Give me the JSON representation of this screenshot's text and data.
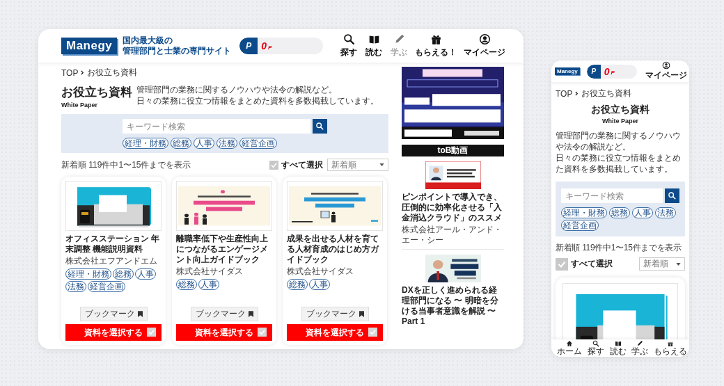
{
  "desktop": {
    "header": {
      "logo": "Manegy",
      "tagline": [
        "国内最大級の",
        "管理部門と士業の専門サイト"
      ],
      "points": {
        "badge": "P",
        "value": "0",
        "unit": "P"
      },
      "nav": [
        {
          "label": "探す",
          "disabled": false
        },
        {
          "label": "読む",
          "disabled": false
        },
        {
          "label": "学ぶ",
          "disabled": true
        },
        {
          "label": "もらえる！",
          "disabled": false
        },
        {
          "label": "マイページ",
          "disabled": false
        }
      ]
    },
    "breadcrumb": [
      "TOP",
      "お役立ち資料"
    ],
    "title": "お役立ち資料",
    "subtitle": "White Paper",
    "description": [
      "管理部門の業務に関するノウハウや法令の解説など。",
      "日々の業務に役立つ情報をまとめた資料を多数掲載しています。"
    ],
    "search": {
      "placeholder": "キーワード検索",
      "tags": [
        "経理・財務",
        "総務",
        "人事",
        "法務",
        "経営企画"
      ]
    },
    "results": {
      "summary": "新着順 119件中1〜15件までを表示",
      "select_all": {
        "label": "すべて選択",
        "checked": false
      },
      "sort": "新着順"
    },
    "cards": [
      {
        "title": "オフィスステーション 年末調整 機能説明資料",
        "company": "株式会社エフアンドエム",
        "tags": [
          "経理・財務",
          "総務",
          "人事",
          "法務",
          "経営企画"
        ],
        "bookmark": "ブックマーク",
        "button": "資料を選択する",
        "checked": false
      },
      {
        "title": "離職率低下や生産性向上につながるエンゲージメント向上ガイドブック",
        "company": "株式会社サイダス",
        "tags": [
          "総務",
          "人事"
        ],
        "bookmark": "ブックマーク",
        "button": "資料を選択する",
        "checked": false
      },
      {
        "title": "成果を出せる人材を育てる人材育成のはじめ方ガイドブック",
        "company": "株式会社サイダス",
        "tags": [
          "総務",
          "人事"
        ],
        "bookmark": "ブックマーク",
        "button": "資料を選択する",
        "checked": false
      }
    ],
    "sidebar": {
      "section_title": "toB動画",
      "videos": [
        {
          "title": "ピンポイントで導入でき、圧倒的に効率化させる「入金消込クラウド」のススメ",
          "company": "株式会社アール・アンド・エー・シー"
        },
        {
          "title": "DXを正しく進められる経理部門になる 〜 明暗を分ける当事者意識を解説 〜 Part 1"
        }
      ]
    }
  },
  "mobile": {
    "header": {
      "logo": "Manegy",
      "points": {
        "badge": "P",
        "value": "0",
        "unit": "P"
      },
      "account": "マイページ"
    },
    "breadcrumb": [
      "TOP",
      "お役立ち資料"
    ],
    "title": "お役立ち資料",
    "subtitle": "White Paper",
    "description": [
      "管理部門の業務に関するノウハウや法令の解説など。",
      "日々の業務に役立つ情報をまとめた資料を多数掲載しています。"
    ],
    "search": {
      "placeholder": "キーワード検索",
      "tags": [
        "経理・財務",
        "総務",
        "人事",
        "法務",
        "経営企画"
      ]
    },
    "results": {
      "summary": "新着順 119件中1〜15件までを表示",
      "select_all": {
        "label": "すべて選択",
        "checked": false
      },
      "sort": "新着順"
    },
    "bottom_nav": [
      {
        "label": "ホーム"
      },
      {
        "label": "探す"
      },
      {
        "label": "読む"
      },
      {
        "label": "学ぶ"
      },
      {
        "label": "もらえる"
      }
    ]
  }
}
